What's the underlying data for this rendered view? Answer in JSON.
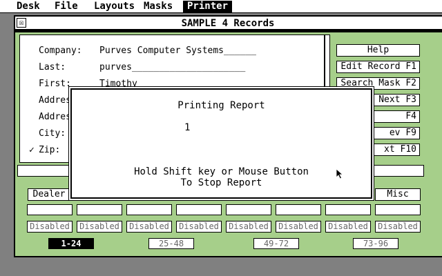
{
  "menubar": {
    "items": [
      {
        "label": "Desk"
      },
      {
        "label": "File"
      },
      {
        "label": "Layouts"
      },
      {
        "label": "Masks"
      },
      {
        "label": "Printer"
      }
    ]
  },
  "window": {
    "close_glyph": "☒",
    "title": "SAMPLE 4 Records"
  },
  "record": {
    "fields": [
      {
        "label": "Company:",
        "value": "Purves Computer Systems______"
      },
      {
        "label": "Last:",
        "value": "purves_____________________"
      },
      {
        "label": "First:",
        "value": "Timothy__________"
      },
      {
        "label": "Addres",
        "value": ""
      },
      {
        "label": "Addres",
        "value": ""
      },
      {
        "label": "City:",
        "value": ""
      },
      {
        "label": "Zip:",
        "value": ""
      }
    ],
    "zip_check": "✓"
  },
  "function_keys": [
    {
      "label": "Help"
    },
    {
      "label": "Edit Record F1"
    },
    {
      "label": "Search Mask F2"
    },
    {
      "label": "Next F3"
    },
    {
      "label": "F4"
    },
    {
      "label": "ev  F9"
    },
    {
      "label": "xt  F10"
    }
  ],
  "bottom": {
    "dealer_label": "Dealer",
    "misc_label": "Misc",
    "disabled_labels": [
      "Disabled",
      "Disabled",
      "Disabled",
      "Disabled",
      "Disabled",
      "Disabled",
      "Disabled",
      "Disabled"
    ],
    "pages": [
      "1-24",
      "25-48",
      "49-72",
      "73-96"
    ]
  },
  "dialog": {
    "title": "Printing Report",
    "count": "1",
    "hint_line1": "Hold Shift key or Mouse Button",
    "hint_line2": "To Stop Report"
  }
}
